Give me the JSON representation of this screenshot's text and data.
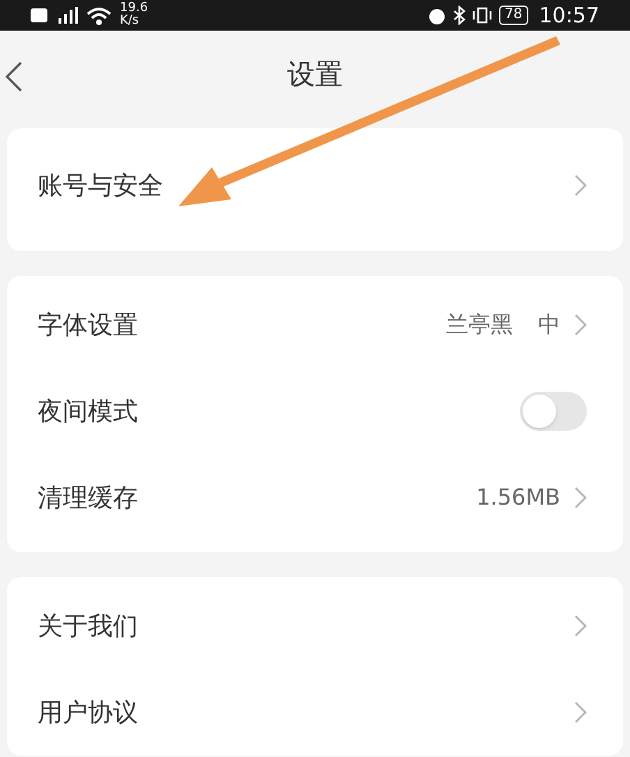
{
  "status_bar": {
    "network_speed": "19.6",
    "speed_unit": "K/s",
    "battery": "78",
    "time": "10:57"
  },
  "header": {
    "title": "设置"
  },
  "groups": [
    {
      "items": [
        {
          "kind": "link",
          "label": "账号与安全"
        }
      ]
    },
    {
      "items": [
        {
          "kind": "link",
          "label": "字体设置",
          "value": "兰亭黑",
          "value_2": "中"
        },
        {
          "kind": "toggle",
          "label": "夜间模式",
          "on": false
        },
        {
          "kind": "link",
          "label": "清理缓存",
          "value": "1.56MB"
        }
      ]
    },
    {
      "items": [
        {
          "kind": "link",
          "label": "关于我们"
        },
        {
          "kind": "link",
          "label": "用户协议"
        }
      ]
    }
  ]
}
